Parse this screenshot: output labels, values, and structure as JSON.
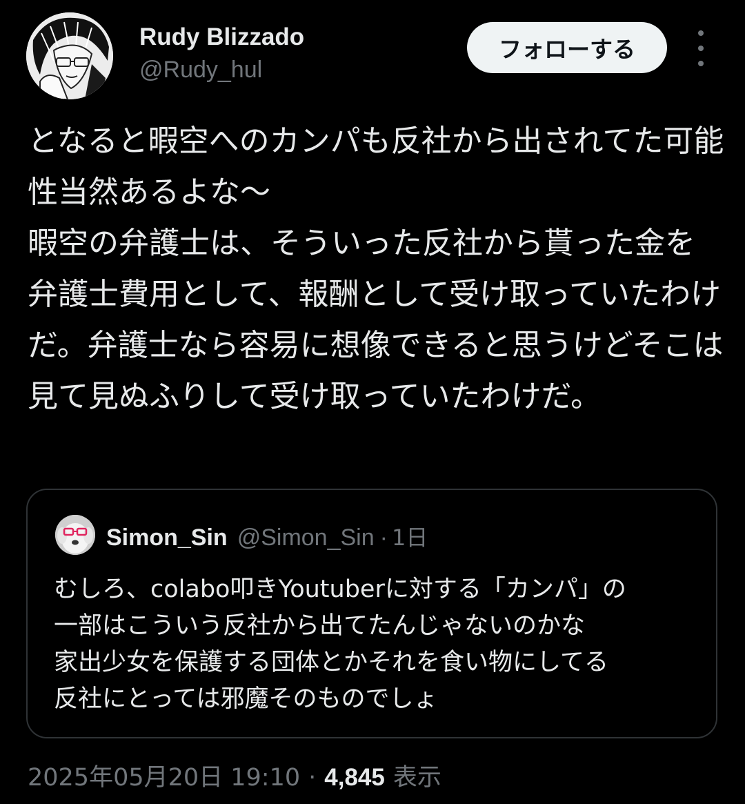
{
  "tweet": {
    "author": {
      "display_name": "Rudy Blizzado",
      "handle": "@Rudy_hul",
      "avatar_icon": "manga-portrait-avatar"
    },
    "follow_label": "フォローする",
    "more_icon": "vertical-ellipsis-icon",
    "text": "となると暇空へのカンパも反社から出されてた可能性当然あるよな〜\n暇空の弁護士は、そういった反社から貰った金を弁護士費用として、報酬として受け取っていたわけだ。弁護士なら容易に想像できると思うけどそこは見て見ぬふりして受け取っていたわけだ。",
    "quoted": {
      "display_name": "Simon_Sin",
      "handle": "@Simon_Sin",
      "separator": "·",
      "time": "1日",
      "avatar_icon": "dog-with-red-glasses-avatar",
      "text": "むしろ、colabo叩きYoutuberに対する「カンパ」の\n一部はこういう反社から出てたんじゃないのかな\n家出少女を保護する団体とかそれを食い物にしてる\n反社にとっては邪魔そのものでしょ"
    },
    "timestamp": "2025年05月20日 19:10",
    "separator": "·",
    "views_count": "4,845",
    "views_label": "表示"
  },
  "colors": {
    "background": "#000000",
    "text_primary": "#e7e9ea",
    "text_secondary": "#71767b",
    "border": "#2f3336",
    "follow_button_bg": "#eff3f4",
    "follow_button_text": "#0f1419"
  }
}
